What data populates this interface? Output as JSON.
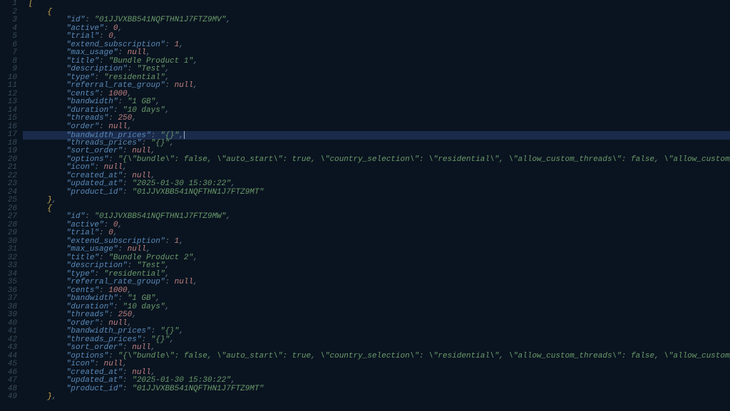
{
  "editor": {
    "highlighted_line": 17,
    "lines": [
      {
        "n": 1,
        "indent": 0,
        "tokens": [
          {
            "t": "brace",
            "v": "["
          }
        ]
      },
      {
        "n": 2,
        "indent": 1,
        "tokens": [
          {
            "t": "brace",
            "v": "{"
          }
        ]
      },
      {
        "n": 3,
        "indent": 2,
        "tokens": [
          {
            "t": "key",
            "v": "\"id\""
          },
          {
            "t": "punct",
            "v": ": "
          },
          {
            "t": "str",
            "v": "\"01JJVXBB541NQFTHN1J7FTZ9MV\""
          },
          {
            "t": "punct",
            "v": ","
          }
        ]
      },
      {
        "n": 4,
        "indent": 2,
        "tokens": [
          {
            "t": "key",
            "v": "\"active\""
          },
          {
            "t": "punct",
            "v": ": "
          },
          {
            "t": "num",
            "v": "0"
          },
          {
            "t": "punct",
            "v": ","
          }
        ]
      },
      {
        "n": 5,
        "indent": 2,
        "tokens": [
          {
            "t": "key",
            "v": "\"trial\""
          },
          {
            "t": "punct",
            "v": ": "
          },
          {
            "t": "num",
            "v": "0"
          },
          {
            "t": "punct",
            "v": ","
          }
        ]
      },
      {
        "n": 6,
        "indent": 2,
        "tokens": [
          {
            "t": "key",
            "v": "\"extend_subscription\""
          },
          {
            "t": "punct",
            "v": ": "
          },
          {
            "t": "num",
            "v": "1"
          },
          {
            "t": "punct",
            "v": ","
          }
        ]
      },
      {
        "n": 7,
        "indent": 2,
        "tokens": [
          {
            "t": "key",
            "v": "\"max_usage\""
          },
          {
            "t": "punct",
            "v": ": "
          },
          {
            "t": "null",
            "v": "null"
          },
          {
            "t": "punct",
            "v": ","
          }
        ]
      },
      {
        "n": 8,
        "indent": 2,
        "tokens": [
          {
            "t": "key",
            "v": "\"title\""
          },
          {
            "t": "punct",
            "v": ": "
          },
          {
            "t": "str",
            "v": "\"Bundle Product 1\""
          },
          {
            "t": "punct",
            "v": ","
          }
        ]
      },
      {
        "n": 9,
        "indent": 2,
        "tokens": [
          {
            "t": "key",
            "v": "\"description\""
          },
          {
            "t": "punct",
            "v": ": "
          },
          {
            "t": "str",
            "v": "\"Test\""
          },
          {
            "t": "punct",
            "v": ","
          }
        ]
      },
      {
        "n": 10,
        "indent": 2,
        "tokens": [
          {
            "t": "key",
            "v": "\"type\""
          },
          {
            "t": "punct",
            "v": ": "
          },
          {
            "t": "str",
            "v": "\"residential\""
          },
          {
            "t": "punct",
            "v": ","
          }
        ]
      },
      {
        "n": 11,
        "indent": 2,
        "tokens": [
          {
            "t": "key",
            "v": "\"referral_rate_group\""
          },
          {
            "t": "punct",
            "v": ": "
          },
          {
            "t": "null",
            "v": "null"
          },
          {
            "t": "punct",
            "v": ","
          }
        ]
      },
      {
        "n": 12,
        "indent": 2,
        "tokens": [
          {
            "t": "key",
            "v": "\"cents\""
          },
          {
            "t": "punct",
            "v": ": "
          },
          {
            "t": "num",
            "v": "1000"
          },
          {
            "t": "punct",
            "v": ","
          }
        ]
      },
      {
        "n": 13,
        "indent": 2,
        "tokens": [
          {
            "t": "key",
            "v": "\"bandwidth\""
          },
          {
            "t": "punct",
            "v": ": "
          },
          {
            "t": "str",
            "v": "\"1 GB\""
          },
          {
            "t": "punct",
            "v": ","
          }
        ]
      },
      {
        "n": 14,
        "indent": 2,
        "tokens": [
          {
            "t": "key",
            "v": "\"duration\""
          },
          {
            "t": "punct",
            "v": ": "
          },
          {
            "t": "str",
            "v": "\"10 days\""
          },
          {
            "t": "punct",
            "v": ","
          }
        ]
      },
      {
        "n": 15,
        "indent": 2,
        "tokens": [
          {
            "t": "key",
            "v": "\"threads\""
          },
          {
            "t": "punct",
            "v": ": "
          },
          {
            "t": "num",
            "v": "250"
          },
          {
            "t": "punct",
            "v": ","
          }
        ]
      },
      {
        "n": 16,
        "indent": 2,
        "tokens": [
          {
            "t": "key",
            "v": "\"order\""
          },
          {
            "t": "punct",
            "v": ": "
          },
          {
            "t": "null",
            "v": "null"
          },
          {
            "t": "punct",
            "v": ","
          }
        ]
      },
      {
        "n": 17,
        "indent": 2,
        "tokens": [
          {
            "t": "key",
            "v": "\"bandwidth_prices\""
          },
          {
            "t": "punct",
            "v": ": "
          },
          {
            "t": "str",
            "v": "\"{}\""
          },
          {
            "t": "punct",
            "v": ","
          }
        ],
        "cursor": true
      },
      {
        "n": 18,
        "indent": 2,
        "tokens": [
          {
            "t": "key",
            "v": "\"threads_prices\""
          },
          {
            "t": "punct",
            "v": ": "
          },
          {
            "t": "str",
            "v": "\"{}\""
          },
          {
            "t": "punct",
            "v": ","
          }
        ]
      },
      {
        "n": 19,
        "indent": 2,
        "tokens": [
          {
            "t": "key",
            "v": "\"sort_order\""
          },
          {
            "t": "punct",
            "v": ": "
          },
          {
            "t": "null",
            "v": "null"
          },
          {
            "t": "punct",
            "v": ","
          }
        ]
      },
      {
        "n": 20,
        "indent": 2,
        "tokens": [
          {
            "t": "key",
            "v": "\"options\""
          },
          {
            "t": "punct",
            "v": ": "
          },
          {
            "t": "str",
            "v": "\"{\\\"bundle\\\": false, \\\"auto_start\\\": true, \\\"country_selection\\\": \\\"residential\\\", \\\"allow_custom_threads\\\": false, \\\"allow_custom_duration\\\": false, \\\"allow_custom_bandwidth\\\": false}\""
          },
          {
            "t": "punct",
            "v": ","
          }
        ]
      },
      {
        "n": 21,
        "indent": 2,
        "tokens": [
          {
            "t": "key",
            "v": "\"icon\""
          },
          {
            "t": "punct",
            "v": ": "
          },
          {
            "t": "null",
            "v": "null"
          },
          {
            "t": "punct",
            "v": ","
          }
        ]
      },
      {
        "n": 22,
        "indent": 2,
        "tokens": [
          {
            "t": "key",
            "v": "\"created_at\""
          },
          {
            "t": "punct",
            "v": ": "
          },
          {
            "t": "null",
            "v": "null"
          },
          {
            "t": "punct",
            "v": ","
          }
        ]
      },
      {
        "n": 23,
        "indent": 2,
        "tokens": [
          {
            "t": "key",
            "v": "\"updated_at\""
          },
          {
            "t": "punct",
            "v": ": "
          },
          {
            "t": "str",
            "v": "\"2025-01-30 15:30:22\""
          },
          {
            "t": "punct",
            "v": ","
          }
        ]
      },
      {
        "n": 24,
        "indent": 2,
        "tokens": [
          {
            "t": "key",
            "v": "\"product_id\""
          },
          {
            "t": "punct",
            "v": ": "
          },
          {
            "t": "str",
            "v": "\"01JJVXBB541NQFTHN1J7FTZ9MT\""
          }
        ]
      },
      {
        "n": 25,
        "indent": 1,
        "tokens": [
          {
            "t": "brace",
            "v": "}"
          },
          {
            "t": "punct",
            "v": ","
          }
        ]
      },
      {
        "n": 26,
        "indent": 1,
        "tokens": [
          {
            "t": "brace",
            "v": "{"
          }
        ]
      },
      {
        "n": 27,
        "indent": 2,
        "tokens": [
          {
            "t": "key",
            "v": "\"id\""
          },
          {
            "t": "punct",
            "v": ": "
          },
          {
            "t": "str",
            "v": "\"01JJVXBB541NQFTHN1J7FTZ9MW\""
          },
          {
            "t": "punct",
            "v": ","
          }
        ]
      },
      {
        "n": 28,
        "indent": 2,
        "tokens": [
          {
            "t": "key",
            "v": "\"active\""
          },
          {
            "t": "punct",
            "v": ": "
          },
          {
            "t": "num",
            "v": "0"
          },
          {
            "t": "punct",
            "v": ","
          }
        ]
      },
      {
        "n": 29,
        "indent": 2,
        "tokens": [
          {
            "t": "key",
            "v": "\"trial\""
          },
          {
            "t": "punct",
            "v": ": "
          },
          {
            "t": "num",
            "v": "0"
          },
          {
            "t": "punct",
            "v": ","
          }
        ]
      },
      {
        "n": 30,
        "indent": 2,
        "tokens": [
          {
            "t": "key",
            "v": "\"extend_subscription\""
          },
          {
            "t": "punct",
            "v": ": "
          },
          {
            "t": "num",
            "v": "1"
          },
          {
            "t": "punct",
            "v": ","
          }
        ]
      },
      {
        "n": 31,
        "indent": 2,
        "tokens": [
          {
            "t": "key",
            "v": "\"max_usage\""
          },
          {
            "t": "punct",
            "v": ": "
          },
          {
            "t": "null",
            "v": "null"
          },
          {
            "t": "punct",
            "v": ","
          }
        ]
      },
      {
        "n": 32,
        "indent": 2,
        "tokens": [
          {
            "t": "key",
            "v": "\"title\""
          },
          {
            "t": "punct",
            "v": ": "
          },
          {
            "t": "str",
            "v": "\"Bundle Product 2\""
          },
          {
            "t": "punct",
            "v": ","
          }
        ]
      },
      {
        "n": 33,
        "indent": 2,
        "tokens": [
          {
            "t": "key",
            "v": "\"description\""
          },
          {
            "t": "punct",
            "v": ": "
          },
          {
            "t": "str",
            "v": "\"Test\""
          },
          {
            "t": "punct",
            "v": ","
          }
        ]
      },
      {
        "n": 34,
        "indent": 2,
        "tokens": [
          {
            "t": "key",
            "v": "\"type\""
          },
          {
            "t": "punct",
            "v": ": "
          },
          {
            "t": "str",
            "v": "\"residential\""
          },
          {
            "t": "punct",
            "v": ","
          }
        ]
      },
      {
        "n": 35,
        "indent": 2,
        "tokens": [
          {
            "t": "key",
            "v": "\"referral_rate_group\""
          },
          {
            "t": "punct",
            "v": ": "
          },
          {
            "t": "null",
            "v": "null"
          },
          {
            "t": "punct",
            "v": ","
          }
        ]
      },
      {
        "n": 36,
        "indent": 2,
        "tokens": [
          {
            "t": "key",
            "v": "\"cents\""
          },
          {
            "t": "punct",
            "v": ": "
          },
          {
            "t": "num",
            "v": "1000"
          },
          {
            "t": "punct",
            "v": ","
          }
        ]
      },
      {
        "n": 37,
        "indent": 2,
        "tokens": [
          {
            "t": "key",
            "v": "\"bandwidth\""
          },
          {
            "t": "punct",
            "v": ": "
          },
          {
            "t": "str",
            "v": "\"1 GB\""
          },
          {
            "t": "punct",
            "v": ","
          }
        ]
      },
      {
        "n": 38,
        "indent": 2,
        "tokens": [
          {
            "t": "key",
            "v": "\"duration\""
          },
          {
            "t": "punct",
            "v": ": "
          },
          {
            "t": "str",
            "v": "\"10 days\""
          },
          {
            "t": "punct",
            "v": ","
          }
        ]
      },
      {
        "n": 39,
        "indent": 2,
        "tokens": [
          {
            "t": "key",
            "v": "\"threads\""
          },
          {
            "t": "punct",
            "v": ": "
          },
          {
            "t": "num",
            "v": "250"
          },
          {
            "t": "punct",
            "v": ","
          }
        ]
      },
      {
        "n": 40,
        "indent": 2,
        "tokens": [
          {
            "t": "key",
            "v": "\"order\""
          },
          {
            "t": "punct",
            "v": ": "
          },
          {
            "t": "null",
            "v": "null"
          },
          {
            "t": "punct",
            "v": ","
          }
        ]
      },
      {
        "n": 41,
        "indent": 2,
        "tokens": [
          {
            "t": "key",
            "v": "\"bandwidth_prices\""
          },
          {
            "t": "punct",
            "v": ": "
          },
          {
            "t": "str",
            "v": "\"{}\""
          },
          {
            "t": "punct",
            "v": ","
          }
        ]
      },
      {
        "n": 42,
        "indent": 2,
        "tokens": [
          {
            "t": "key",
            "v": "\"threads_prices\""
          },
          {
            "t": "punct",
            "v": ": "
          },
          {
            "t": "str",
            "v": "\"{}\""
          },
          {
            "t": "punct",
            "v": ","
          }
        ]
      },
      {
        "n": 43,
        "indent": 2,
        "tokens": [
          {
            "t": "key",
            "v": "\"sort_order\""
          },
          {
            "t": "punct",
            "v": ": "
          },
          {
            "t": "null",
            "v": "null"
          },
          {
            "t": "punct",
            "v": ","
          }
        ]
      },
      {
        "n": 44,
        "indent": 2,
        "tokens": [
          {
            "t": "key",
            "v": "\"options\""
          },
          {
            "t": "punct",
            "v": ": "
          },
          {
            "t": "str",
            "v": "\"{\\\"bundle\\\": false, \\\"auto_start\\\": true, \\\"country_selection\\\": \\\"residential\\\", \\\"allow_custom_threads\\\": false, \\\"allow_custom_duration\\\": false, \\\"allow_custom_bandwidth\\\": false}\""
          },
          {
            "t": "punct",
            "v": ","
          }
        ]
      },
      {
        "n": 45,
        "indent": 2,
        "tokens": [
          {
            "t": "key",
            "v": "\"icon\""
          },
          {
            "t": "punct",
            "v": ": "
          },
          {
            "t": "null",
            "v": "null"
          },
          {
            "t": "punct",
            "v": ","
          }
        ]
      },
      {
        "n": 46,
        "indent": 2,
        "tokens": [
          {
            "t": "key",
            "v": "\"created_at\""
          },
          {
            "t": "punct",
            "v": ": "
          },
          {
            "t": "null",
            "v": "null"
          },
          {
            "t": "punct",
            "v": ","
          }
        ]
      },
      {
        "n": 47,
        "indent": 2,
        "tokens": [
          {
            "t": "key",
            "v": "\"updated_at\""
          },
          {
            "t": "punct",
            "v": ": "
          },
          {
            "t": "str",
            "v": "\"2025-01-30 15:30:22\""
          },
          {
            "t": "punct",
            "v": ","
          }
        ]
      },
      {
        "n": 48,
        "indent": 2,
        "tokens": [
          {
            "t": "key",
            "v": "\"product_id\""
          },
          {
            "t": "punct",
            "v": ": "
          },
          {
            "t": "str",
            "v": "\"01JJVXBB541NQFTHN1J7FTZ9MT\""
          }
        ]
      },
      {
        "n": 49,
        "indent": 1,
        "tokens": [
          {
            "t": "brace",
            "v": "}"
          },
          {
            "t": "punct",
            "v": ","
          }
        ]
      }
    ]
  }
}
